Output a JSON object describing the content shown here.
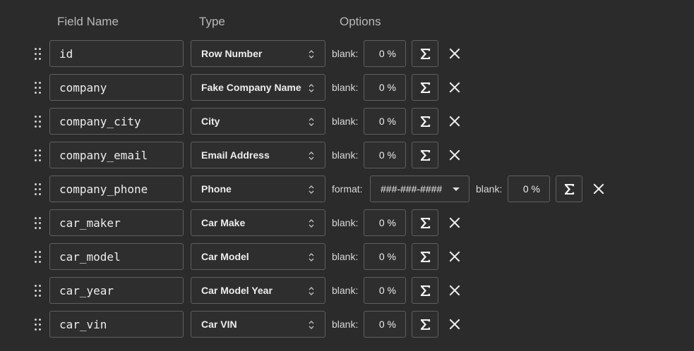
{
  "headers": {
    "field_name": "Field Name",
    "type": "Type",
    "options": "Options"
  },
  "rows": [
    {
      "name": "id",
      "type": "Row Number",
      "blank_label": "blank:",
      "blank": "0 %"
    },
    {
      "name": "company",
      "type": "Fake Company Name",
      "blank_label": "blank:",
      "blank": "0 %"
    },
    {
      "name": "company_city",
      "type": "City",
      "blank_label": "blank:",
      "blank": "0 %"
    },
    {
      "name": "company_email",
      "type": "Email Address",
      "blank_label": "blank:",
      "blank": "0 %"
    },
    {
      "name": "company_phone",
      "type": "Phone",
      "format_label": "format:",
      "format": "###-###-####",
      "blank_label": "blank:",
      "blank": "0 %"
    },
    {
      "name": "car_maker",
      "type": "Car Make",
      "blank_label": "blank:",
      "blank": "0 %"
    },
    {
      "name": "car_model",
      "type": "Car Model",
      "blank_label": "blank:",
      "blank": "0 %"
    },
    {
      "name": "car_year",
      "type": "Car Model Year",
      "blank_label": "blank:",
      "blank": "0 %"
    },
    {
      "name": "car_vin",
      "type": "Car VIN",
      "blank_label": "blank:",
      "blank": "0 %"
    }
  ],
  "icons": {
    "drag": "drag-handle-icon",
    "type_select": "up-down-chevron-icon",
    "formula": "sigma-icon",
    "remove": "close-icon",
    "format_dropdown": "caret-down-icon"
  }
}
